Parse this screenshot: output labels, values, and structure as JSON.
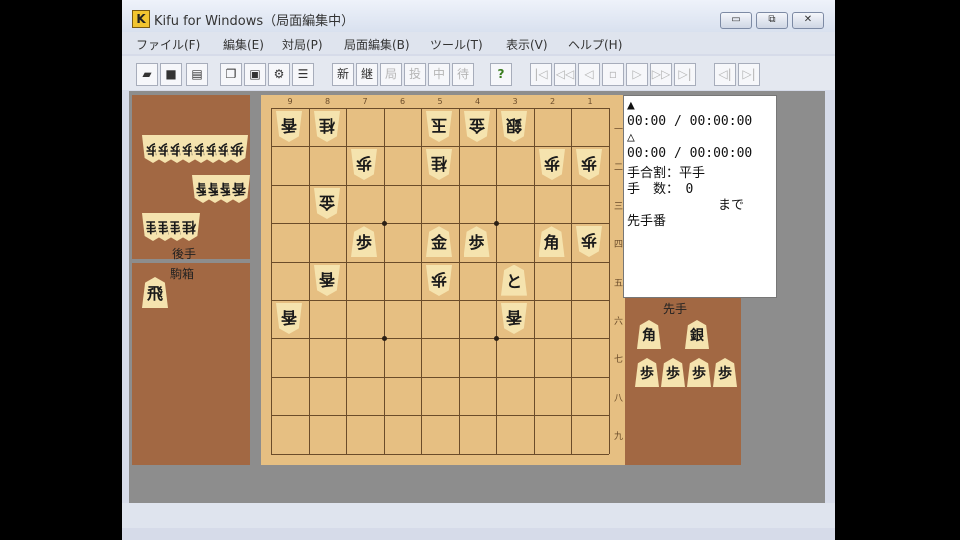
{
  "window": {
    "title": "Kifu for Windows（局面編集中）",
    "app_icon_letter": "K",
    "buttons": [
      "▭",
      "⧉",
      "✕"
    ]
  },
  "menu": [
    "ファイル(F)",
    "編集(E)",
    "対局(P)",
    "局面編集(B)",
    "ツール(T)",
    "表示(V)",
    "ヘルプ(H)"
  ],
  "toolbar": {
    "new_label": "新",
    "continue_label": "継",
    "btn_kaeru": "局",
    "btn_chu": "投",
    "btn_naka": "中",
    "btn_matta": "待",
    "help_label": "?"
  },
  "board": {
    "files": [
      "9",
      "8",
      "7",
      "6",
      "5",
      "4",
      "3",
      "2",
      "1"
    ],
    "ranks": [
      "一",
      "二",
      "三",
      "四",
      "五",
      "六",
      "七",
      "八",
      "九"
    ],
    "pieces": [
      {
        "file": 9,
        "rank": 1,
        "label": "香",
        "side": "gote"
      },
      {
        "file": 8,
        "rank": 1,
        "label": "桂",
        "side": "gote"
      },
      {
        "file": 5,
        "rank": 1,
        "label": "玉",
        "side": "gote"
      },
      {
        "file": 4,
        "rank": 1,
        "label": "金",
        "side": "gote"
      },
      {
        "file": 3,
        "rank": 1,
        "label": "銀",
        "side": "gote"
      },
      {
        "file": 7,
        "rank": 2,
        "label": "歩",
        "side": "gote"
      },
      {
        "file": 5,
        "rank": 2,
        "label": "桂",
        "side": "gote"
      },
      {
        "file": 2,
        "rank": 2,
        "label": "歩",
        "side": "gote"
      },
      {
        "file": 1,
        "rank": 2,
        "label": "歩",
        "side": "gote"
      },
      {
        "file": 8,
        "rank": 3,
        "label": "金",
        "side": "gote"
      },
      {
        "file": 7,
        "rank": 4,
        "label": "歩",
        "side": "sente"
      },
      {
        "file": 5,
        "rank": 4,
        "label": "金",
        "side": "sente"
      },
      {
        "file": 4,
        "rank": 4,
        "label": "歩",
        "side": "sente"
      },
      {
        "file": 2,
        "rank": 4,
        "label": "角",
        "side": "sente"
      },
      {
        "file": 1,
        "rank": 4,
        "label": "歩",
        "side": "gote"
      },
      {
        "file": 8,
        "rank": 5,
        "label": "香",
        "side": "gote"
      },
      {
        "file": 5,
        "rank": 5,
        "label": "歩",
        "side": "gote"
      },
      {
        "file": 3,
        "rank": 5,
        "label": "と",
        "side": "sente"
      },
      {
        "file": 9,
        "rank": 6,
        "label": "香",
        "side": "gote"
      },
      {
        "file": 3,
        "rank": 6,
        "label": "香",
        "side": "gote"
      }
    ]
  },
  "gote_stand": {
    "label1": "後手",
    "label2": "駒箱",
    "pieces": [
      "歩",
      "歩",
      "歩",
      "歩",
      "歩",
      "歩",
      "歩",
      "歩",
      "香",
      "香",
      "香",
      "香",
      "桂",
      "桂",
      "桂",
      "桂"
    ],
    "box_piece": "飛"
  },
  "sente_stand": {
    "label": "先手",
    "pieces": [
      "角",
      "銀",
      "歩",
      "歩",
      "歩",
      "歩"
    ]
  },
  "info": {
    "sente_mark": "▲",
    "sente_time": "00:00 / 00:00:00",
    "gote_mark": "△",
    "gote_time": "00:00 / 00:00:00",
    "handicap": "手合割：平手",
    "moves": "手　数：　0",
    "made": "まで",
    "turn": "先手番"
  }
}
